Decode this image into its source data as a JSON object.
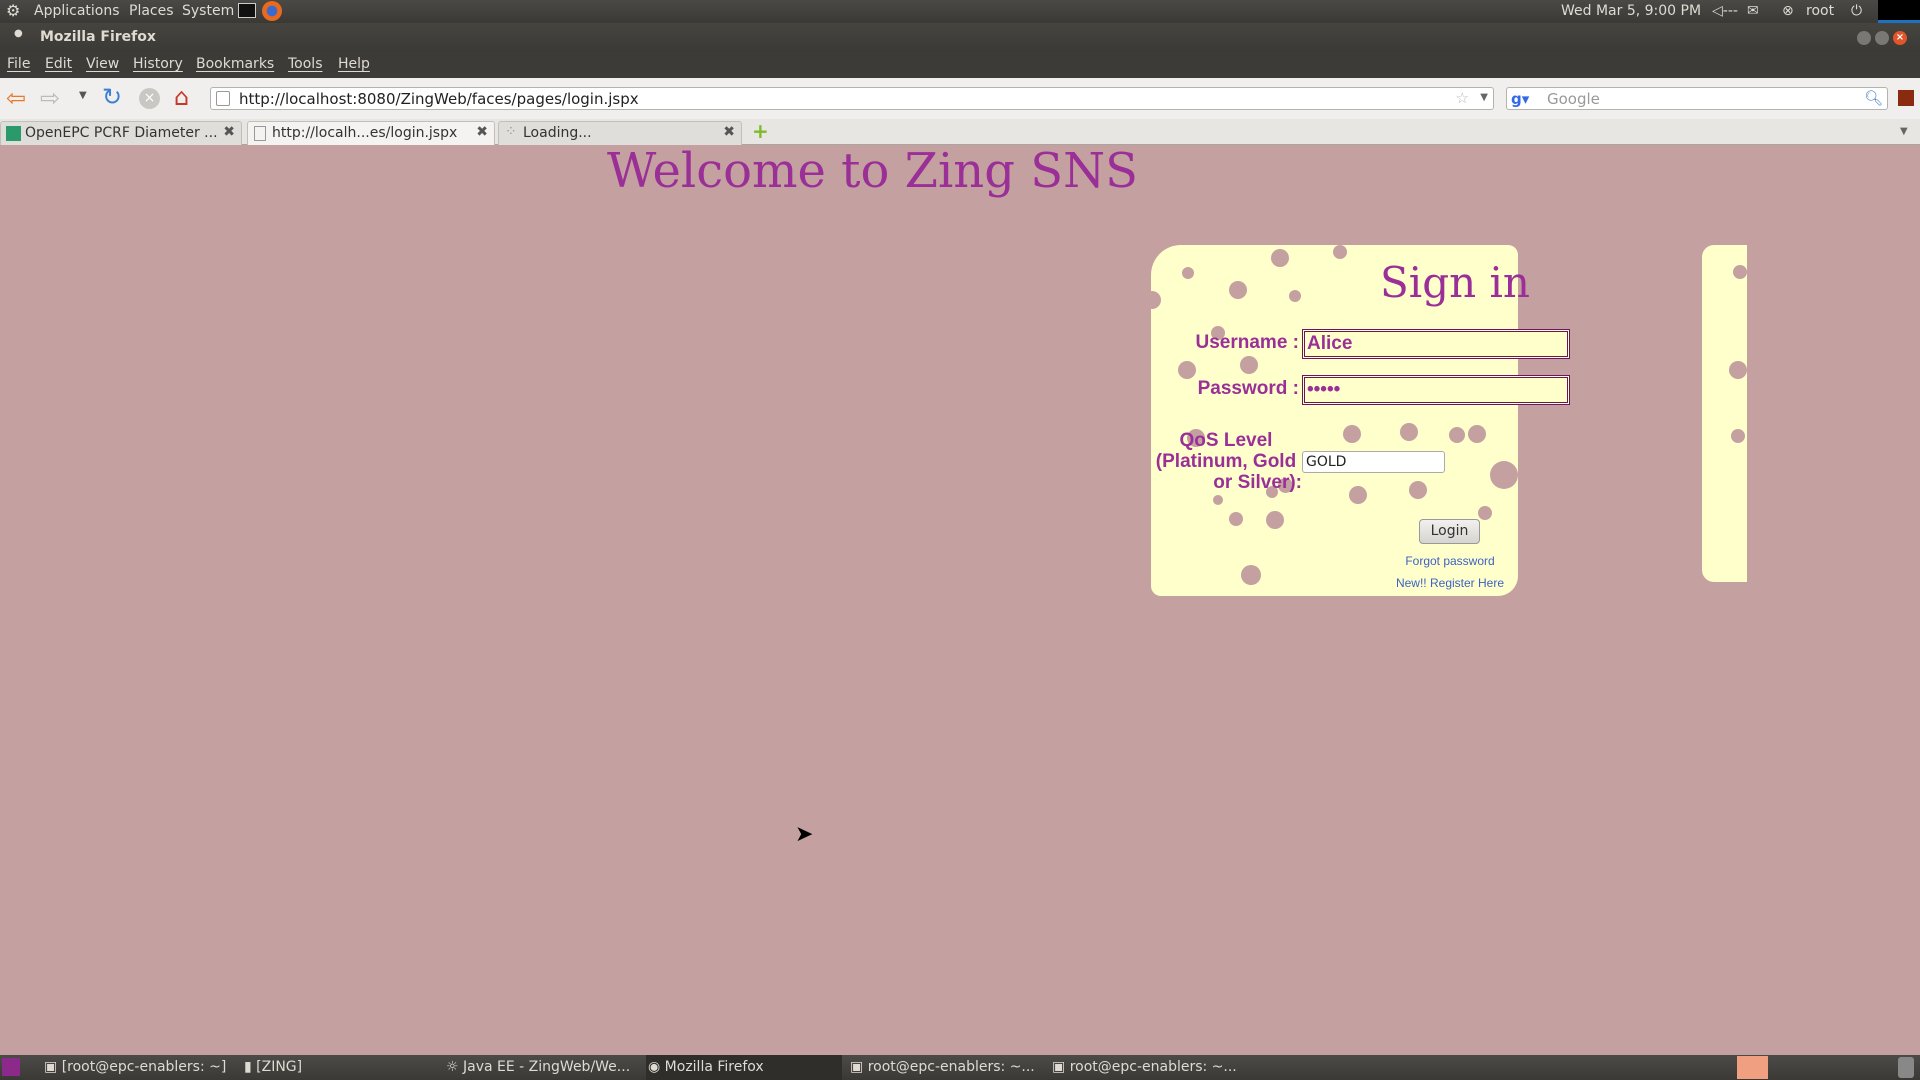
{
  "top_panel": {
    "menus": [
      "Applications",
      "Places",
      "System"
    ],
    "clock": "Wed Mar  5,  9:00 PM",
    "user": "root"
  },
  "window": {
    "title": "Mozilla Firefox"
  },
  "menubar": [
    "File",
    "Edit",
    "View",
    "History",
    "Bookmarks",
    "Tools",
    "Help"
  ],
  "navbar": {
    "url": "http://localhost:8080/ZingWeb/faces/pages/login.jspx",
    "search_placeholder": "Google"
  },
  "tabs": [
    {
      "label": "OpenEPC PCRF Diameter ..."
    },
    {
      "label": "http://localh...es/login.jspx",
      "active": true
    },
    {
      "label": "Loading..."
    }
  ],
  "page": {
    "heading": "Welcome to Zing SNS",
    "signin_title": "Sign in",
    "username_label": "Username :",
    "username_value": "Alice",
    "password_label": "Password :",
    "password_value": "•••••",
    "qos_label_lines": [
      "QoS Level",
      "(Platinum, Gold",
      "or Silver):"
    ],
    "qos_value": "GOLD",
    "login_button": "Login",
    "forgot_link": "Forgot password",
    "register_link": "New!! Register Here"
  },
  "taskbar": [
    "[root@epc-enablers: ~]",
    "[ZING]",
    "Java EE - ZingWeb/We...",
    "Mozilla Firefox",
    "root@epc-enablers: ~...",
    "root@epc-enablers: ~..."
  ],
  "colors": {
    "page_bg": "#c4a0a0",
    "card_bg": "#ffffcc",
    "accent": "#9b2f98"
  }
}
